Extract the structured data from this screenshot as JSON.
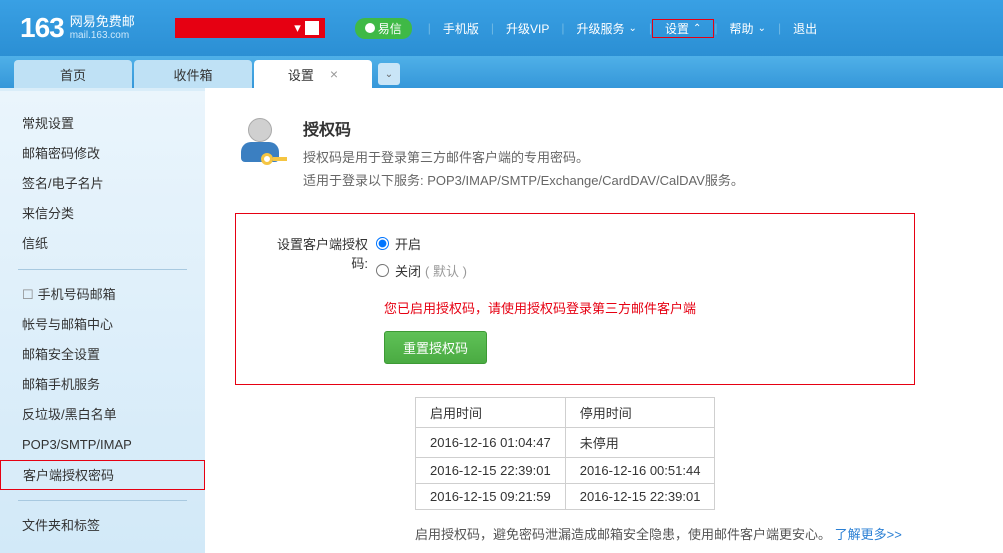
{
  "header": {
    "logo": "163",
    "logo_cn": "网易免费邮",
    "logo_en": "mail.163.com",
    "red_caret": "▾",
    "yixin": "易信",
    "links": {
      "mobile": "手机版",
      "vip": "升级VIP",
      "service": "升级服务",
      "settings": "设置",
      "help": "帮助",
      "exit": "退出"
    }
  },
  "tabs": {
    "home": "首页",
    "inbox": "收件箱",
    "settings": "设置"
  },
  "sidebar": {
    "general": "常规设置",
    "password": "邮箱密码修改",
    "signature": "签名/电子名片",
    "classify": "来信分类",
    "paper": "信纸",
    "phone_mail": "手机号码邮箱",
    "account_center": "帐号与邮箱中心",
    "security": "邮箱安全设置",
    "phone_service": "邮箱手机服务",
    "antispam": "反垃圾/黑白名单",
    "pop3": "POP3/SMTP/IMAP",
    "client_auth": "客户端授权密码",
    "folder_label": "文件夹和标签"
  },
  "main": {
    "title": "授权码",
    "desc1": "授权码是用于登录第三方邮件客户端的专用密码。",
    "desc2": "适用于登录以下服务: POP3/IMAP/SMTP/Exchange/CardDAV/CalDAV服务。",
    "panel": {
      "label": "设置客户端授权码:",
      "opt_on": "开启",
      "opt_off": "关闭",
      "opt_off_hint": "( 默认 )",
      "warn": "您已启用授权码，请使用授权码登录第三方邮件客户端",
      "reset_btn": "重置授权码"
    },
    "table": {
      "col_enable": "启用时间",
      "col_disable": "停用时间",
      "rows": [
        {
          "enable": "2016-12-16 01:04:47",
          "disable": "未停用"
        },
        {
          "enable": "2016-12-15 22:39:01",
          "disable": "2016-12-16 00:51:44"
        },
        {
          "enable": "2016-12-15 09:21:59",
          "disable": "2016-12-15 22:39:01"
        }
      ]
    },
    "foot_note_text": "启用授权码，避免密码泄漏造成邮箱安全隐患，使用邮件客户端更安心。",
    "foot_note_link": "了解更多>>"
  }
}
